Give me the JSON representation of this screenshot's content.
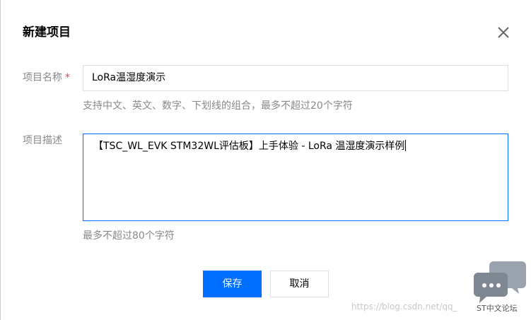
{
  "dialog": {
    "title": "新建项目",
    "close_icon": "close-icon"
  },
  "form": {
    "name_label": "项目名称",
    "required_mark": "*",
    "name_value": "LoRa温湿度演示",
    "name_hint": "支持中文、英文、数字、下划线的组合，最多不超过20个字符",
    "desc_label": "项目描述",
    "desc_value": "【TSC_WL_EVK STM32WL评估板】上手体验 - LoRa 温湿度演示样例",
    "desc_hint": "最多不超过80个字符"
  },
  "actions": {
    "save_label": "保存",
    "cancel_label": "取消"
  },
  "watermark": {
    "url_text": "https://blog.csdn.net/qq_",
    "logo_text": "ST中文论坛",
    "logo_icon": "chat-bubbles-icon"
  },
  "colors": {
    "primary": "#006eff",
    "required": "#e54545",
    "label": "#888888",
    "border": "#dcdfe6"
  }
}
